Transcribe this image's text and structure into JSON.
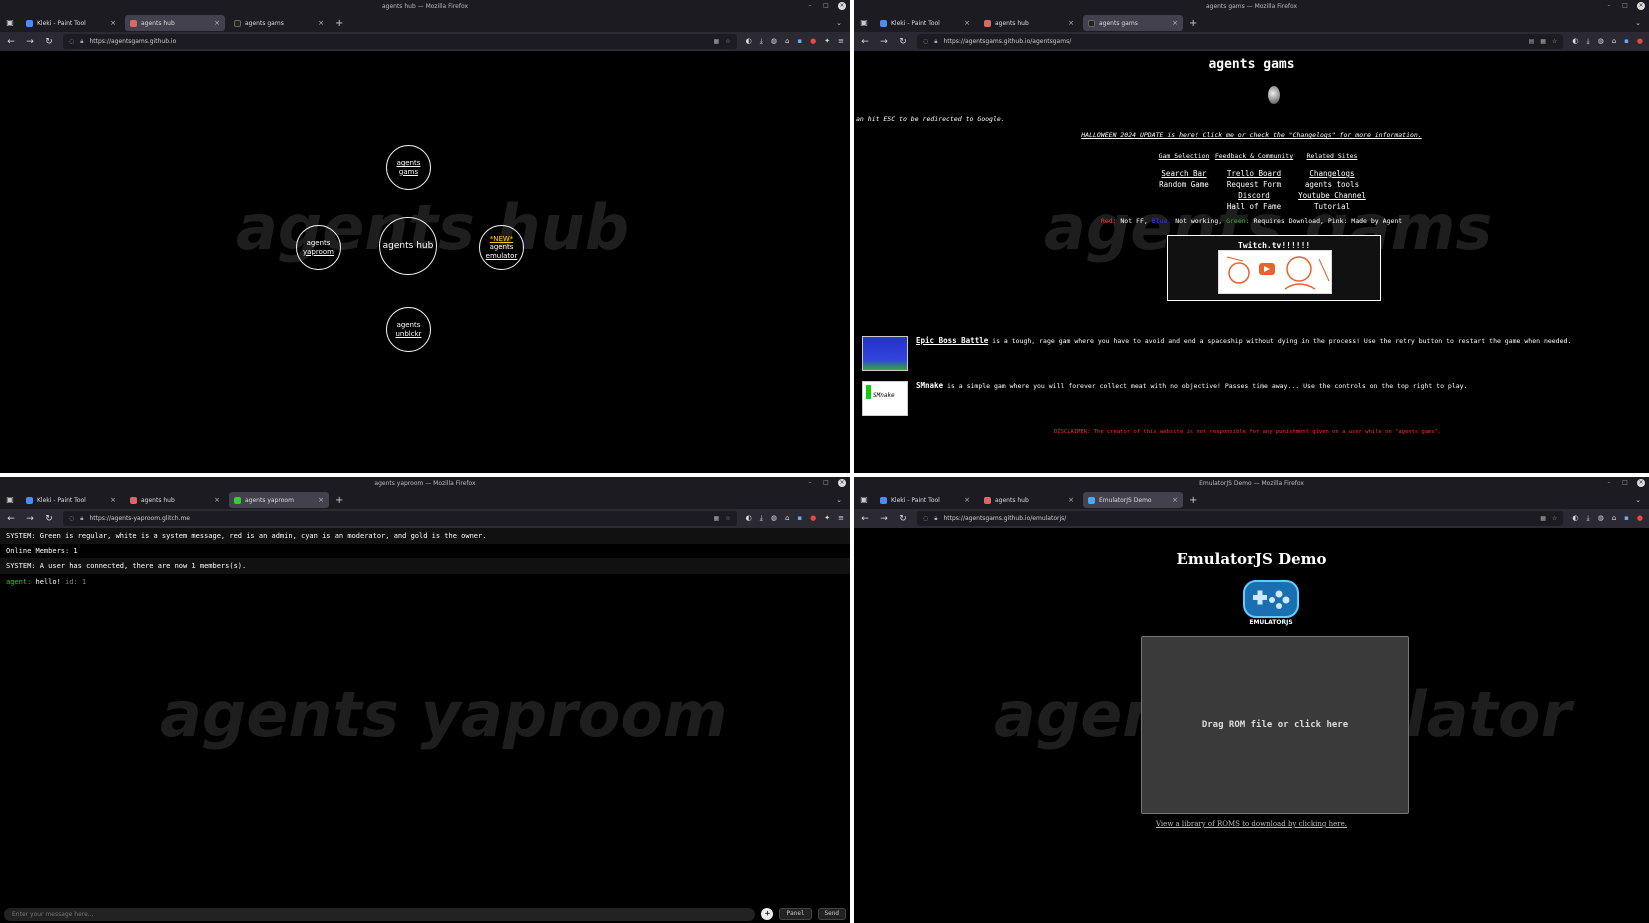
{
  "windows": {
    "hub": {
      "title": "agents hub — Mozilla Firefox",
      "tabs": [
        {
          "label": "Kleki - Paint Tool",
          "active": false,
          "color": "#4a8cff"
        },
        {
          "label": "agents hub",
          "active": true,
          "color": "#d66"
        },
        {
          "label": "agents gams",
          "active": false,
          "color": "#222"
        }
      ],
      "url": "https://agentsgams.github.io",
      "watermark": "agents hub",
      "circles": {
        "gams": "agents gams",
        "yaproom_line1": "agents",
        "yaproom_line2": "yaproom",
        "center": "agents hub",
        "emulator_new": "*NEW*",
        "emulator_line1": "agents",
        "emulator_line2": "emulator",
        "unblockr_line1": "agents",
        "unblockr_line2": "unblckr"
      }
    },
    "gams": {
      "title": "agents gams — Mozilla Firefox",
      "tabs": [
        {
          "label": "Kleki - Paint Tool",
          "active": false,
          "color": "#4a8cff"
        },
        {
          "label": "agents hub",
          "active": false,
          "color": "#d66"
        },
        {
          "label": "agents gams",
          "active": true,
          "color": "#222"
        }
      ],
      "url": "https://agentsgams.github.io/agentsgams/",
      "watermark": "agents gams",
      "heading": "agents gams",
      "esc_note": "an hit ESC to be redirected to Google.",
      "halloween": "HALLOWEEN 2024 UPDATE is here! Click me or check the \"Changelogs\" for more information.",
      "menu": {
        "col1": {
          "header": "Gam Selection",
          "items": [
            "Search Bar",
            "Random Game"
          ]
        },
        "col2": {
          "header": "Feedback & Community",
          "items": [
            "Trello Board",
            "Request Form",
            "Discord",
            "Hall of Fame"
          ]
        },
        "col3": {
          "header": "Related Sites",
          "items": [
            "Changelogs",
            "agents tools",
            "Youtube Channel",
            "Tutorial"
          ]
        }
      },
      "legend": {
        "red": "Red:",
        "red_text": " Not FF, ",
        "blue": "Blue:",
        "blue_text": " Not working, ",
        "green": "Green:",
        "green_text": " Requires Download, Pink: Made by Agent"
      },
      "twitch_banner": "Twitch.tv!!!!!!",
      "games": [
        {
          "name": "Epic Boss Battle",
          "desc": " is a tough, rage gam where you have to avoid and end a spaceship without dying in the process! Use the retry button to restart the game when needed."
        },
        {
          "name": "SMnake",
          "desc": " is a simple gam where you will forever collect meat with no objective! Passes time away... Use the controls on the top right to play."
        }
      ],
      "disclaimer": "DISCLAIMER: The creator of this website is not responsible for any punishment given on a user while on \"agents gams\"."
    },
    "yaproom": {
      "title": "agents yaproom — Mozilla Firefox",
      "tabs": [
        {
          "label": "Kleki - Paint Tool",
          "active": false,
          "color": "#4a8cff"
        },
        {
          "label": "agents hub",
          "active": false,
          "color": "#d66"
        },
        {
          "label": "agents yaproom",
          "active": true,
          "color": "#3c3"
        }
      ],
      "url": "https://agents-yaproom.glitch.me",
      "watermark": "agents yaproom",
      "system_legend": "SYSTEM: Green is regular, white is a system message, red is an admin, cyan is an moderator, and gold is the owner.",
      "online_members": "Online Members: 1",
      "connect_msg": "SYSTEM: A user has connected, there are now 1 members(s).",
      "chat_user": "agent:",
      "chat_text": " hello!",
      "chat_id": " id: 1",
      "input_placeholder": "Enter your message here...",
      "panel_label": "Panel",
      "send_label": "Send"
    },
    "emulator": {
      "title": "EmulatorJS Demo — Mozilla Firefox",
      "tabs": [
        {
          "label": "Kleki - Paint Tool",
          "active": false,
          "color": "#4a8cff"
        },
        {
          "label": "agents hub",
          "active": false,
          "color": "#d66"
        },
        {
          "label": "EmulatorJS Demo",
          "active": true,
          "color": "#4af"
        }
      ],
      "url": "https://agentsgams.github.io/emulatorjs/",
      "watermark": "agents emulator",
      "heading": "EmulatorJS Demo",
      "logo_text": "EMULATORJS",
      "drop_label": "Drag ROM file or click here",
      "roms_link": "View a library of ROMS to download by clicking here."
    }
  }
}
